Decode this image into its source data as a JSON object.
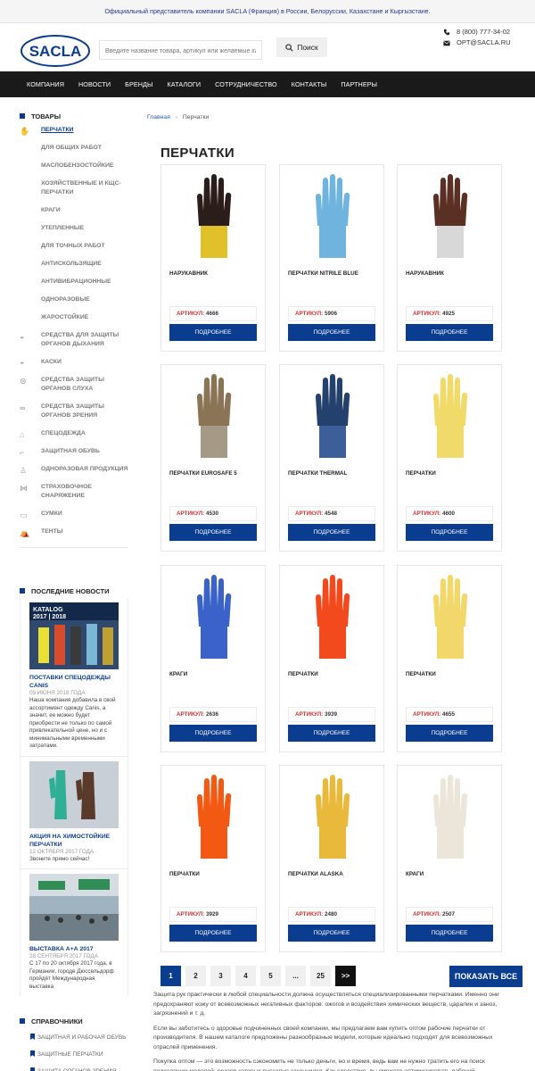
{
  "topbar": {
    "text": "Официальный представитель компании SACLA (Франция) в России, Белоруссии, Казахстане и Кыргызстане."
  },
  "header": {
    "logo_text": "SACLA",
    "search_placeholder": "Введите название товара, артикул или желаемые ха",
    "search_button": "Поиск",
    "phone": "8 (800) 777-34-02",
    "email": "OPT@SACLA.RU"
  },
  "nav": [
    "КОМПАНИЯ",
    "НОВОСТИ",
    "БРЕНДЫ",
    "КАТАЛОГИ",
    "СОТРУДНИЧЕСТВО",
    "КОНТАКТЫ",
    "ПАРТНЕРЫ"
  ],
  "sidebar": {
    "title": "ТОВАРЫ",
    "items": [
      {
        "label": "ПЕРЧАТКИ",
        "icon": "glove-icon",
        "active": true
      },
      {
        "label": "ДЛЯ ОБЩИХ РАБОТ"
      },
      {
        "label": "МАСЛОБЕНЗОСТОЙКИЕ"
      },
      {
        "label": "ХОЗЯЙСТВЕННЫЕ И КЩС-ПЕРЧАТКИ"
      },
      {
        "label": "КРАГИ"
      },
      {
        "label": "УТЕПЛЕННЫЕ"
      },
      {
        "label": "ДЛЯ ТОЧНЫХ РАБОТ"
      },
      {
        "label": "АНТИСКОЛЬЗЯЩИЕ"
      },
      {
        "label": "АНТИВИБРАЦИОННЫЕ"
      },
      {
        "label": "ОДНОРАЗОВЫЕ"
      },
      {
        "label": "ЖАРОСТОЙКИЕ"
      },
      {
        "label": "СРЕДСТВА ДЛЯ ЗАЩИТЫ ОРГАНОВ ДЫХАНИЯ",
        "icon": "respirator-icon"
      },
      {
        "label": "КАСКИ",
        "icon": "helmet-icon"
      },
      {
        "label": "СРЕДСТВА ЗАЩИТЫ ОРГАНОВ СЛУХА",
        "icon": "earmuffs-icon"
      },
      {
        "label": "СРЕДСТВА ЗАЩИТЫ ОРГАНОВ ЗРЕНИЯ",
        "icon": "goggles-icon"
      },
      {
        "label": "СПЕЦОДЕЖДА",
        "icon": "jacket-icon"
      },
      {
        "label": "ЗАЩИТНАЯ ОБУВЬ",
        "icon": "boot-icon"
      },
      {
        "label": "ОДНОРАЗОВАЯ ПРОДУКЦИЯ",
        "icon": "coverall-icon"
      },
      {
        "label": "СТРАХОВОЧНОЕ СНАРЯЖЕНИЕ",
        "icon": "harness-icon"
      },
      {
        "label": "СУМКИ",
        "icon": "bag-icon"
      },
      {
        "label": "ТЕНТЫ",
        "icon": "tent-icon"
      }
    ]
  },
  "news": {
    "title": "ПОСЛЕДНИЕ НОВОСТИ",
    "items": [
      {
        "img_text": "KATALOG 2017 | 2018",
        "title": "ПОСТАВКИ СПЕЦОДЕЖДЫ CANIS",
        "date": "09 ИЮНЯ 2018 ГОДА",
        "text": "Наша компания добавила в свой ассортимент одежду Canis, а значит, ее можно будет приобрести не только по самой привлекательной цене, но и с минимальными временными затратами."
      },
      {
        "title": "АКЦИЯ НА ХИМОСТОЙКИЕ ПЕРЧАТКИ",
        "date": "12 ОКТЯБРЯ 2017 ГОДА",
        "text": "Звоните прямо сейчас!"
      },
      {
        "title": "ВЫСТАВКА А+А 2017",
        "date": "28 СЕНТЯБРЯ 2017 ГОДА",
        "text": "С 17 по 20 октября 2017 года, в Германии, городе Дюссельдорф пройдёт Международная выставка"
      }
    ]
  },
  "refs": {
    "title": "СПРАВОЧНИКИ",
    "items": [
      "ЗАЩИТНАЯ И РАБОЧАЯ ОБУВЬ",
      "ЗАЩИТНЫЕ ПЕРЧАТКИ",
      "ЗАЩИТА ОРГАНОВ ЗРЕНИЯ"
    ]
  },
  "breadcrumb": {
    "home": "Главная",
    "sep": "›",
    "current": "Перчатки"
  },
  "page_title": "ПЕРЧАТКИ",
  "labels": {
    "article": "АРТИКУЛ:",
    "more": "ПОДРОБНЕЕ"
  },
  "products": [
    {
      "name": "НАРУКАВНИК",
      "article": "4666",
      "palm": "#2a1d1a",
      "cuff": "#e2c02a"
    },
    {
      "name": "ПЕРЧАТКИ NITRILE BLUE",
      "article": "5906",
      "palm": "#6fb4df",
      "cuff": "#6fb4df"
    },
    {
      "name": "НАРУКАВНИК",
      "article": "4925",
      "palm": "#5a2f24",
      "cuff": "#d8d8d8"
    },
    {
      "name": "ПЕРЧАТКИ EUROSAFE 5",
      "article": "4530",
      "palm": "#8b7455",
      "cuff": "#a59a86"
    },
    {
      "name": "ПЕРЧАТКИ THERMAL",
      "article": "4548",
      "palm": "#24416e",
      "cuff": "#3c5f9a"
    },
    {
      "name": "ПЕРЧАТКИ",
      "article": "4600",
      "palm": "#f0db6a",
      "cuff": "#f0db6a"
    },
    {
      "name": "КРАГИ",
      "article": "2636",
      "palm": "#3a62c8",
      "cuff": "#3a62c8"
    },
    {
      "name": "ПЕРЧАТКИ",
      "article": "3939",
      "palm": "#f24a1c",
      "cuff": "#f24a1c"
    },
    {
      "name": "ПЕРЧАТКИ",
      "article": "4655",
      "palm": "#f2d86a",
      "cuff": "#f2d86a"
    },
    {
      "name": "ПЕРЧАТКИ",
      "article": "3929",
      "palm": "#f25a14",
      "cuff": "#f25a14"
    },
    {
      "name": "ПЕРЧАТКИ ALASKA",
      "article": "2480",
      "palm": "#e8b93a",
      "cuff": "#e8b93a"
    },
    {
      "name": "КРАГИ",
      "article": "2507",
      "palm": "#ece6da",
      "cuff": "#ece6da"
    }
  ],
  "pagination": [
    "1",
    "2",
    "3",
    "4",
    "5",
    "...",
    "25",
    ">>"
  ],
  "show_all": "ПОКАЗАТЬ ВСЕ",
  "description": [
    "Защита рук практически в любой специальности должна осуществляться специализированными перчатками. Именно они предохраняют кожу от всевозможных негативных факторов: ожогов и воздействия химических веществ, царапин и заноз, загрязнений и т. д.",
    "Если вы заботитесь о здоровье подчиненных своей компании, мы предлагаем вам купить оптом рабочие перчатки от производителя. В нашем каталоге предложены разнообразные модели, которые идеально подходят для всевозможных отраслей применения.",
    "Покупка оптом — это возможность сэкономить не только деньги, но и время, ведь вам не нужно тратить его на поиск подходящих моделей, резерв которых внезапно закончился. Как следствие, вы сможете оптимизировать рабочий"
  ]
}
